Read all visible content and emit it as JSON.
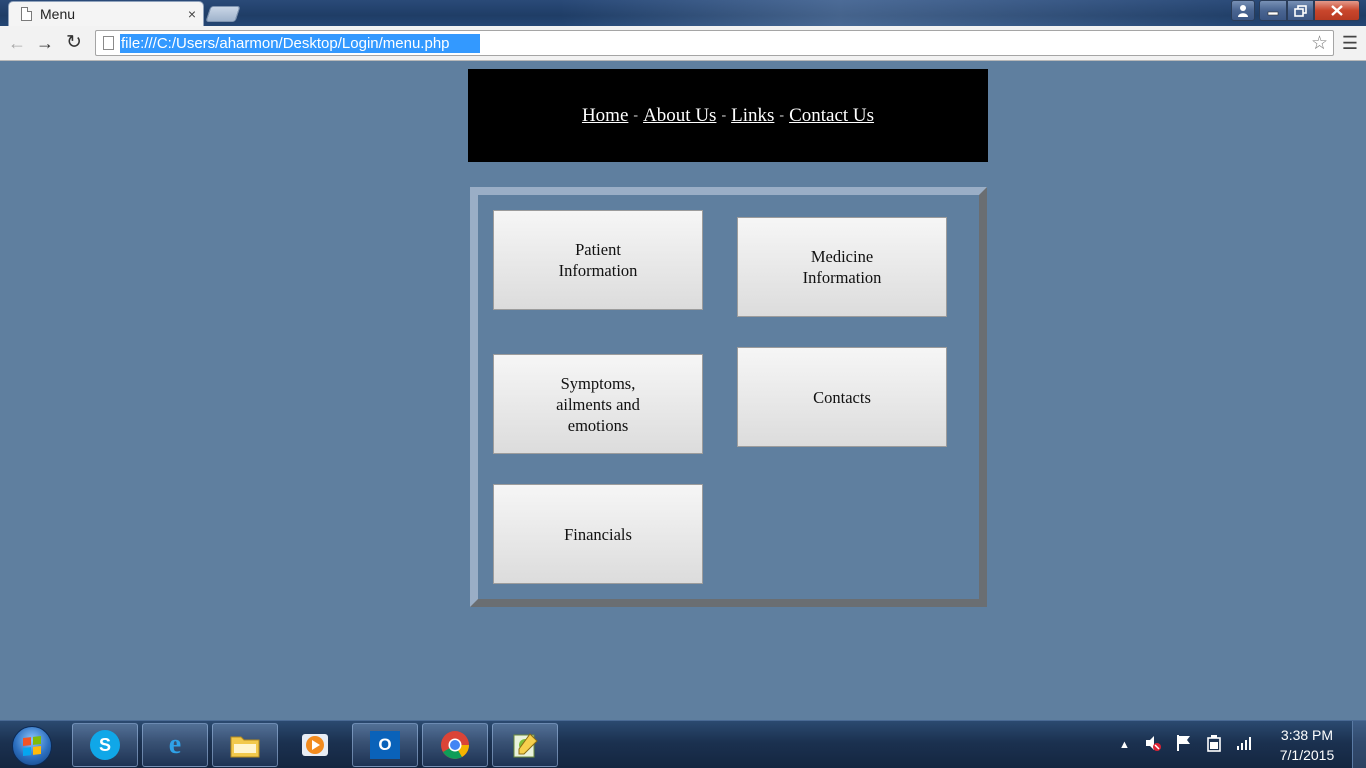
{
  "browser": {
    "tab_title": "Menu",
    "tab_close": "×",
    "address": "file:///C:/Users/aharmon/Desktop/Login/menu.php"
  },
  "nav": {
    "links": [
      "Home",
      "About Us",
      "Links",
      "Contact Us"
    ],
    "separator": "-"
  },
  "menu": {
    "patient_info": "Patient Information",
    "medicine_info": "Medicine Information",
    "symptoms": "Symptoms, ailments and emotions",
    "contacts": "Contacts",
    "financials": "Financials"
  },
  "taskbar": {
    "time": "3:38 PM",
    "date": "7/1/2015"
  },
  "colors": {
    "page_background": "#5f7f9f",
    "header_background": "#000000",
    "button_gradient_top": "#f6f6f6",
    "button_gradient_bottom": "#dcdcdc"
  }
}
